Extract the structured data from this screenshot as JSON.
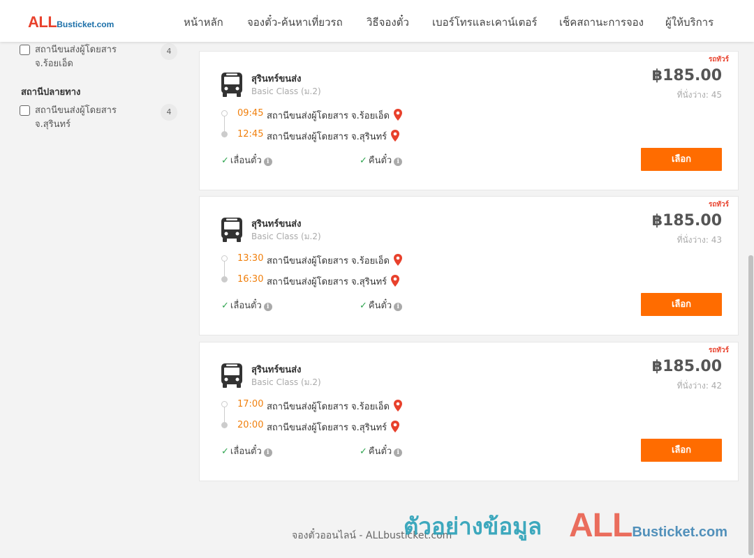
{
  "brand": {
    "logo_all": "ALL",
    "logo_rest": "Busticket.com",
    "accent": "#ff6c00",
    "red": "#e8412c"
  },
  "nav": {
    "items": [
      {
        "label": "หน้าหลัก"
      },
      {
        "label": "จองตั๋ว-ค้นหาเที่ยวรถ"
      },
      {
        "label": "วิธีจองตั๋ว"
      },
      {
        "label": "เบอร์โทรและเคาน์เตอร์"
      },
      {
        "label": "เช็คสถานะการจอง"
      },
      {
        "label": "ผู้ให้บริการ"
      }
    ]
  },
  "sidebar": {
    "origin_option": {
      "label": "สถานีขนส่งผู้โดยสาร จ.ร้อยเอ็ด",
      "count": "4",
      "checked": false
    },
    "destination_heading": "สถานีปลายทาง",
    "destination_option": {
      "label": "สถานีขนส่งผู้โดยสาร จ.สุรินทร์",
      "count": "4",
      "checked": false
    }
  },
  "trips": [
    {
      "tag": "รถทัวร์",
      "operator": "สุรินทร์ขนส่ง",
      "bus_class": "Basic Class (ม.2)",
      "depart_time": "09:45",
      "depart_station": "สถานีขนส่งผู้โดยสาร จ.ร้อยเอ็ด",
      "arrive_time": "12:45",
      "arrive_station": "สถานีขนส่งผู้โดยสาร จ.สุรินทร์",
      "price": "฿185.00",
      "seats": "ที่นั่งว่าง: 45",
      "feature_change": "เลื่อนตั๋ว",
      "feature_refund": "คืนตั๋ว",
      "select_label": "เลือก"
    },
    {
      "tag": "รถทัวร์",
      "operator": "สุรินทร์ขนส่ง",
      "bus_class": "Basic Class (ม.2)",
      "depart_time": "13:30",
      "depart_station": "สถานีขนส่งผู้โดยสาร จ.ร้อยเอ็ด",
      "arrive_time": "16:30",
      "arrive_station": "สถานีขนส่งผู้โดยสาร จ.สุรินทร์",
      "price": "฿185.00",
      "seats": "ที่นั่งว่าง: 43",
      "feature_change": "เลื่อนตั๋ว",
      "feature_refund": "คืนตั๋ว",
      "select_label": "เลือก"
    },
    {
      "tag": "รถทัวร์",
      "operator": "สุรินทร์ขนส่ง",
      "bus_class": "Basic Class (ม.2)",
      "depart_time": "17:00",
      "depart_station": "สถานีขนส่งผู้โดยสาร จ.ร้อยเอ็ด",
      "arrive_time": "20:00",
      "arrive_station": "สถานีขนส่งผู้โดยสาร จ.สุรินทร์",
      "price": "฿185.00",
      "seats": "ที่นั่งว่าง: 42",
      "feature_change": "เลื่อนตั๋ว",
      "feature_refund": "คืนตั๋ว",
      "select_label": "เลือก"
    }
  ],
  "footer": {
    "text": "จองตั๋วออนไลน์ - ALLbusticket.com",
    "watermark_text": "ตัวอย่างข้อมูล",
    "watermark_logo_all": "ALL",
    "watermark_logo_rest": "Busticket.com"
  }
}
